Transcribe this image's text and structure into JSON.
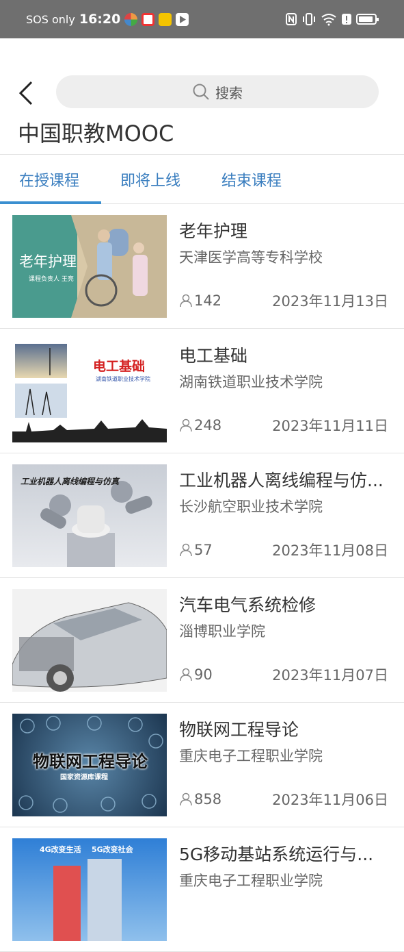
{
  "status": {
    "sos": "SOS only",
    "time": "16:20"
  },
  "search": {
    "placeholder": "搜索"
  },
  "header": {
    "title": "中国职教MOOC"
  },
  "tabs": [
    {
      "label": "在授课程",
      "active": true
    },
    {
      "label": "即将上线",
      "active": false
    },
    {
      "label": "结束课程",
      "active": false
    }
  ],
  "courses": [
    {
      "title": "老年护理",
      "school": "天津医学高等专科学校",
      "students": "142",
      "date": "2023年11月13日",
      "thumb_text": "老年护理",
      "thumb_sub": "课程负责人  王亮"
    },
    {
      "title": "电工基础",
      "school": "湖南铁道职业技术学院",
      "students": "248",
      "date": "2023年11月11日",
      "thumb_text": "电工基础",
      "thumb_sub": "湖南铁道职业技术学院"
    },
    {
      "title": "工业机器人离线编程与仿...",
      "school": "长沙航空职业技术学院",
      "students": "57",
      "date": "2023年11月08日",
      "thumb_text": "工业机器人离线编程与仿真"
    },
    {
      "title": "汽车电气系统检修",
      "school": "淄博职业学院",
      "students": "90",
      "date": "2023年11月07日"
    },
    {
      "title": "物联网工程导论",
      "school": "重庆电子工程职业学院",
      "students": "858",
      "date": "2023年11月06日",
      "thumb_text": "物联网工程导论",
      "thumb_sub": "国家资源库课程"
    },
    {
      "title": "5G移动基站系统运行与...",
      "school": "重庆电子工程职业学院",
      "students": "",
      "date": "",
      "thumb_text": "4G改变生活    5G改变社会"
    }
  ],
  "colors": {
    "accent": "#3a7ebf",
    "statusbar": "#6f6f6f"
  }
}
